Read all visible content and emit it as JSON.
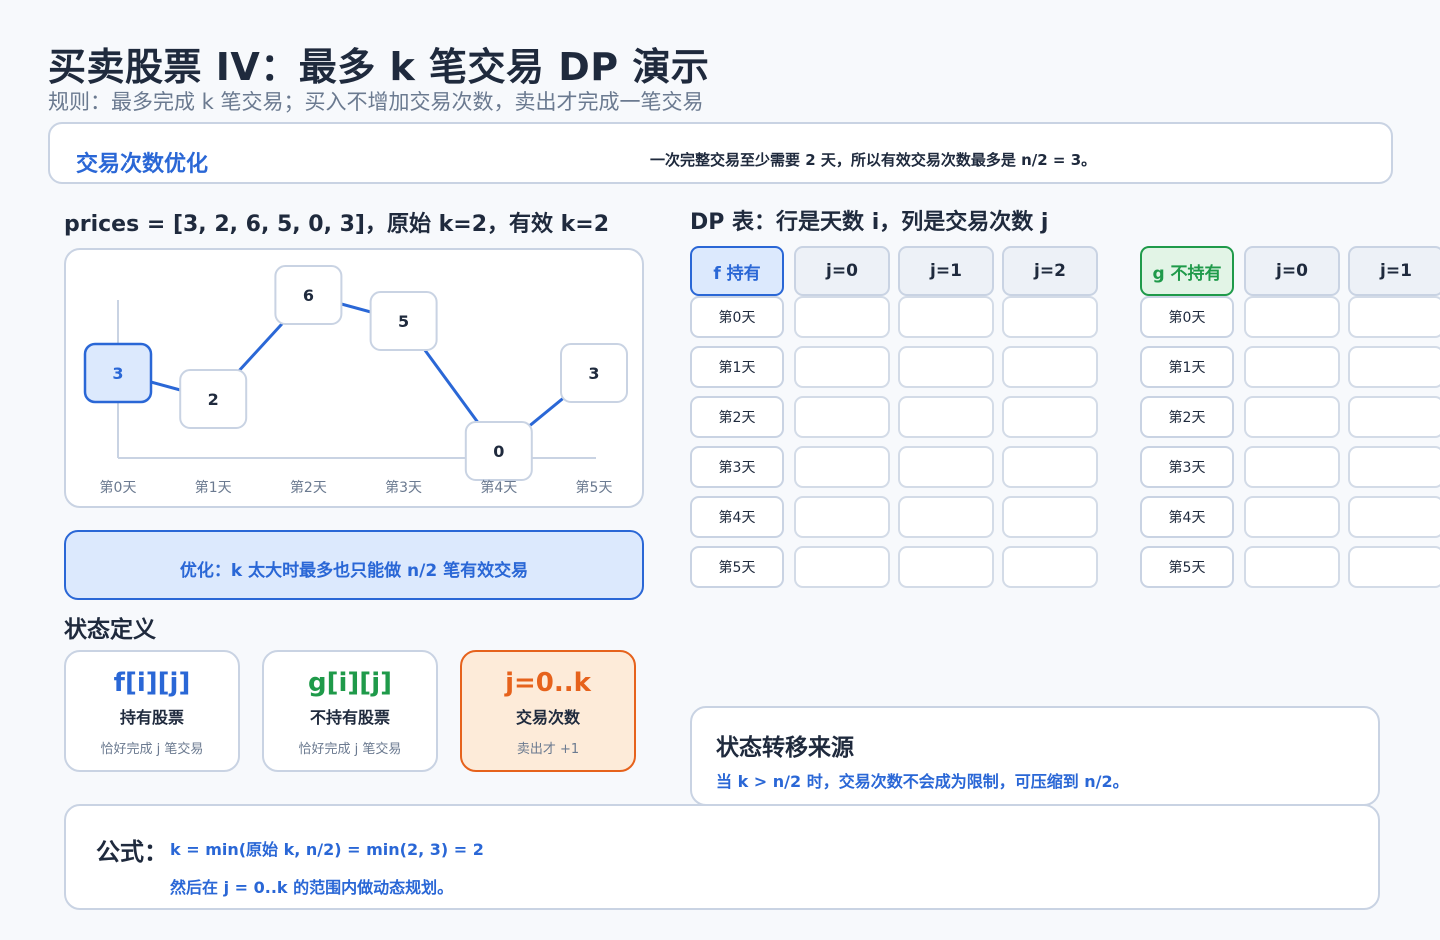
{
  "header": {
    "title": "买卖股票 IV：最多 k 笔交易 DP 演示",
    "subtitle": "规则：最多完成 k 笔交易；买入不增加交易次数，卖出才完成一笔交易"
  },
  "banner": {
    "title": "交易次数优化",
    "note": "一次完整交易至少需要 2 天，所以有效交易次数最多是 n/2 = 3。"
  },
  "prices_panel": {
    "label": "prices = [3, 2, 6, 5, 0, 3]，原始 k=2，有效 k=2"
  },
  "chart_data": {
    "type": "line",
    "categories": [
      "第0天",
      "第1天",
      "第2天",
      "第3天",
      "第4天",
      "第5天"
    ],
    "values": [
      3,
      2,
      6,
      5,
      0,
      3
    ],
    "value_labels": [
      "3",
      "2",
      "6",
      "5",
      "0",
      "3"
    ],
    "highlight_index": 0,
    "colors": {
      "line": "#2a67d6",
      "highlight_fill": "#dce9fd",
      "highlight_stroke": "#2a67d6",
      "node_stroke": "#c9d3e3",
      "axis": "#c9d3e3"
    }
  },
  "optimization": {
    "text": "优化：k 太大时最多也只能做 n/2 笔有效交易"
  },
  "states": {
    "label": "状态定义",
    "cards": [
      {
        "symbol": "f[i][j]",
        "name": "持有股票",
        "desc": "恰好完成 j 笔交易"
      },
      {
        "symbol": "g[i][j]",
        "name": "不持有股票",
        "desc": "恰好完成 j 笔交易"
      },
      {
        "symbol": "j=0..k",
        "name": "交易次数",
        "desc": "卖出才 +1"
      }
    ]
  },
  "dp_table": {
    "label": "DP 表：行是天数 i，列是交易次数 j",
    "f_header": "f 持有",
    "g_header": "g 不持有",
    "f_columns": [
      "j=0",
      "j=1",
      "j=2"
    ],
    "g_columns": [
      "j=0",
      "j=1"
    ],
    "rows": [
      "第0天",
      "第1天",
      "第2天",
      "第3天",
      "第4天",
      "第5天"
    ]
  },
  "transition": {
    "title": "状态转移来源",
    "note": "当 k > n/2 时，交易次数不会成为限制，可压缩到 n/2。"
  },
  "formula": {
    "label": "公式：",
    "line1": "k = min(原始 k, n/2) = min(2, 3) = 2",
    "line2": "然后在 j = 0..k 的范围内做动态规划。"
  }
}
